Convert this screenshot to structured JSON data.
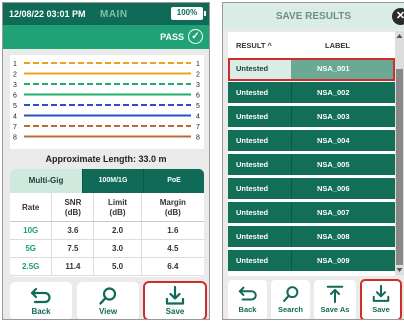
{
  "left_screen": {
    "status": {
      "time": "12/08/22 03:01 PM",
      "mode": "MAIN",
      "battery": "100%"
    },
    "pass_label": "PASS",
    "wiremap": {
      "left_pins": [
        "1",
        "2",
        "3",
        "6",
        "5",
        "4",
        "7",
        "8"
      ],
      "right_pins": [
        "1",
        "2",
        "3",
        "6",
        "5",
        "4",
        "7",
        "8"
      ],
      "pair_colors": [
        "#f0a020",
        "#f0a020",
        "#1fb06a",
        "#1fb06a",
        "#2850c8",
        "#2850c8",
        "#b86a30",
        "#b86a30"
      ]
    },
    "length_text": "Approximate Length: 33.0 m",
    "tabs": [
      "Multi-Gig",
      "100M/1G",
      "PoE"
    ],
    "table": {
      "headers": [
        {
          "line1": "Rate",
          "line2": ""
        },
        {
          "line1": "SNR",
          "line2": "(dB)"
        },
        {
          "line1": "Limit",
          "line2": "(dB)"
        },
        {
          "line1": "Margin",
          "line2": "(dB)"
        }
      ],
      "rows": [
        {
          "rate": "10G",
          "snr": "3.6",
          "limit": "2.0",
          "margin": "1.6"
        },
        {
          "rate": "5G",
          "snr": "7.5",
          "limit": "3.0",
          "margin": "4.5"
        },
        {
          "rate": "2.5G",
          "snr": "11.4",
          "limit": "5.0",
          "margin": "6.4"
        }
      ]
    },
    "nav": {
      "back": "Back",
      "view": "View",
      "save": "Save"
    }
  },
  "right_screen": {
    "title": "SAVE RESULTS",
    "close_glyph": "✕",
    "columns": {
      "result": "RESULT ^",
      "label": "LABEL"
    },
    "rows": [
      {
        "result": "Untested",
        "label": "NSA_001"
      },
      {
        "result": "Untested",
        "label": "NSA_002"
      },
      {
        "result": "Untested",
        "label": "NSA_003"
      },
      {
        "result": "Untested",
        "label": "NSA_004"
      },
      {
        "result": "Untested",
        "label": "NSA_005"
      },
      {
        "result": "Untested",
        "label": "NSA_006"
      },
      {
        "result": "Untested",
        "label": "NSA_007"
      },
      {
        "result": "Untested",
        "label": "NSA_008"
      },
      {
        "result": "Untested",
        "label": "NSA_009"
      }
    ],
    "selected_row": 0,
    "nav": {
      "back": "Back",
      "search": "Search",
      "save_as": "Save As",
      "save": "Save"
    }
  },
  "colors": {
    "header_green": "#0f6b57",
    "pass_green": "#21a276",
    "row_green": "#136e58",
    "highlight_red": "#cf2c2c"
  }
}
